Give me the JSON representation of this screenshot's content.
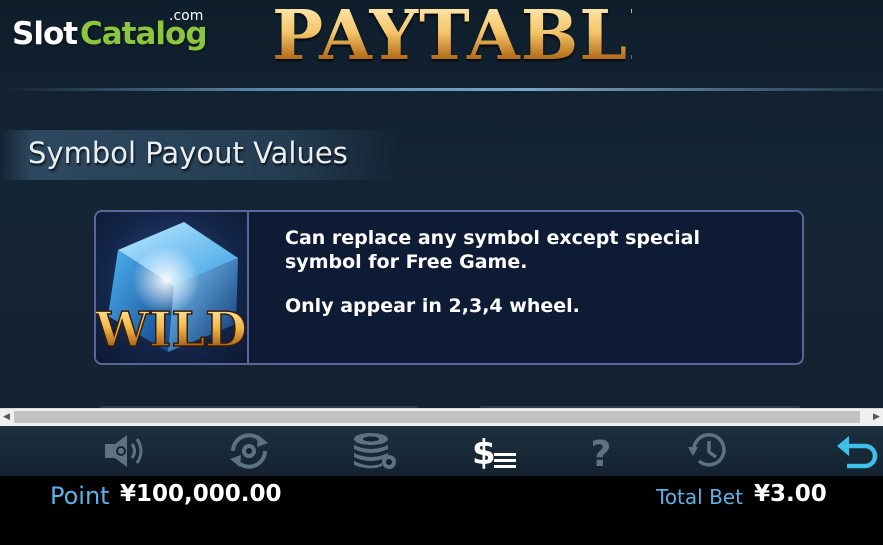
{
  "logo": {
    "part1": "Slot",
    "part2": "Catalog",
    "suffix": ".com"
  },
  "title": "PAYTABLE",
  "section": {
    "title": "Symbol Payout Values"
  },
  "symbol_card": {
    "symbol_label": "WILD",
    "lines": [
      "Can replace any symbol except special symbol for Free Game.",
      "Only appear in 2,3,4 wheel."
    ]
  },
  "toolbar": {
    "buttons": [
      {
        "icon": "sound-icon",
        "active": false
      },
      {
        "icon": "autoplay-icon",
        "active": false
      },
      {
        "icon": "chips-settings-icon",
        "active": false
      },
      {
        "icon": "paytable-icon",
        "active": true
      },
      {
        "icon": "help-icon",
        "active": false
      },
      {
        "icon": "history-icon",
        "active": false
      },
      {
        "icon": "back-icon",
        "active": true
      }
    ]
  },
  "balance": {
    "label": "Point",
    "value": "¥100,000.00"
  },
  "bet": {
    "label": "Total Bet",
    "value": "¥3.00"
  },
  "colors": {
    "accent_blue": "#5ab2e6",
    "title_gold": "#f1c56a",
    "card_border": "#5a6698",
    "icon_inactive": "#5d7384",
    "icon_active": "#ffffff",
    "back_icon": "#3ec0e8"
  }
}
